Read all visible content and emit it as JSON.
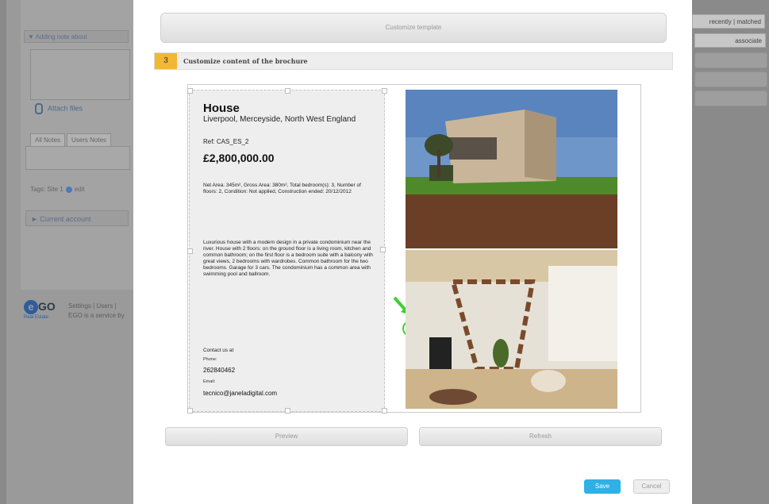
{
  "left_panel": {
    "note_header": "Adding note about",
    "attach_files": "Attach files",
    "tabs": [
      "All Notes",
      "Users Notes"
    ],
    "tags_text": "Tags: Site 1",
    "tags_edit": "edit",
    "current_account": "Current account",
    "logo_text": "GO",
    "logo_sub": "Real Estate",
    "footer_line1": "Settings | Users |",
    "footer_line2": "EGO is a service by"
  },
  "right_panel": {
    "top_label": "recently | matched",
    "associate_label": "associate"
  },
  "modal": {
    "customize_template": "Customize template",
    "step_number": "3",
    "step_title": "Customize content of the brochure",
    "preview_label": "Preview",
    "refresh_label": "Refresh",
    "save_label": "Save",
    "cancel_label": "Cancel"
  },
  "brochure": {
    "title": "House",
    "location": "Liverpool, Merceyside, North West England",
    "ref": "Ref: CAS_ES_2",
    "price": "£2,800,000.00",
    "specs": "Net Area: 345m², Gross Area: 380m², Total bedroom(s): 3, Number of floors: 2, Condition: Not applied, Construction ended: 20/12/2012",
    "description": "Luxurious house with a modern design in a private condominium near the river. House with 2 floors: on the ground floor is a living room, kitchen and common bathroom; on the first floor is a bedroom suite with a balcony with great views, 2 bedrooms with wardrobes. Common bathroom for the two bedrooms. Garage for 3 cars. The condominium has a common area with swimming pool and ballroom.",
    "contact_label": "Contact us at",
    "phone_label": "Phone:",
    "phone": "262840462",
    "email_label": "Email:",
    "email": "tecnico@janeladigital.com"
  },
  "colors": {
    "step_accent": "#f2b733",
    "save_button": "#2fb0e6",
    "arrow": "#3bd12e"
  }
}
